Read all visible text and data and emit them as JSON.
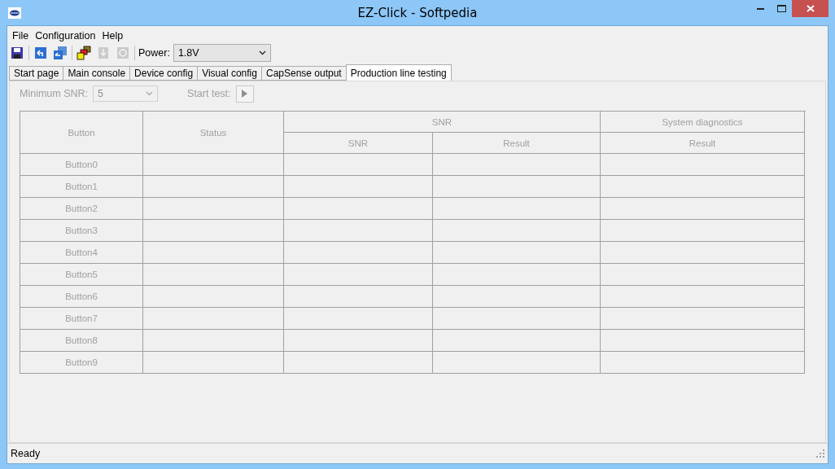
{
  "window": {
    "title": "EZ-Click - Softpedia"
  },
  "menu": [
    "File",
    "Configuration",
    "Help"
  ],
  "toolbar": [
    {
      "kind": "save",
      "disabled": false
    },
    {
      "kind": "sep"
    },
    {
      "kind": "undo",
      "disabled": false
    },
    {
      "kind": "redo",
      "disabled": false
    },
    {
      "kind": "sep"
    },
    {
      "kind": "squares",
      "disabled": false
    },
    {
      "kind": "download",
      "disabled": true
    },
    {
      "kind": "sync",
      "disabled": true
    },
    {
      "kind": "sep"
    }
  ],
  "power": {
    "label": "Power:",
    "value": "1.8V"
  },
  "tabs": [
    {
      "label": "Start page",
      "selected": false
    },
    {
      "label": "Main console",
      "selected": false
    },
    {
      "label": "Device config",
      "selected": false
    },
    {
      "label": "Visual config",
      "selected": false
    },
    {
      "label": "CapSense output",
      "selected": false
    },
    {
      "label": "Production line testing",
      "selected": true
    }
  ],
  "controls": {
    "min_snr": {
      "label": "Minimum SNR:",
      "value": "5",
      "disabled": true
    },
    "start_test": {
      "label": "Start test:",
      "disabled": true
    }
  },
  "table": {
    "columns": [
      {
        "label": "Button"
      },
      {
        "label": "Status"
      },
      {
        "label": "SNR",
        "children": [
          "SNR",
          "Result"
        ]
      },
      {
        "label": "System diagnostics",
        "children": [
          "Result"
        ]
      }
    ],
    "rows": [
      {
        "button": "Button0"
      },
      {
        "button": "Button1"
      },
      {
        "button": "Button2"
      },
      {
        "button": "Button3"
      },
      {
        "button": "Button4"
      },
      {
        "button": "Button5"
      },
      {
        "button": "Button6"
      },
      {
        "button": "Button7"
      },
      {
        "button": "Button8"
      },
      {
        "button": "Button9"
      }
    ]
  },
  "status_bar": "Ready"
}
